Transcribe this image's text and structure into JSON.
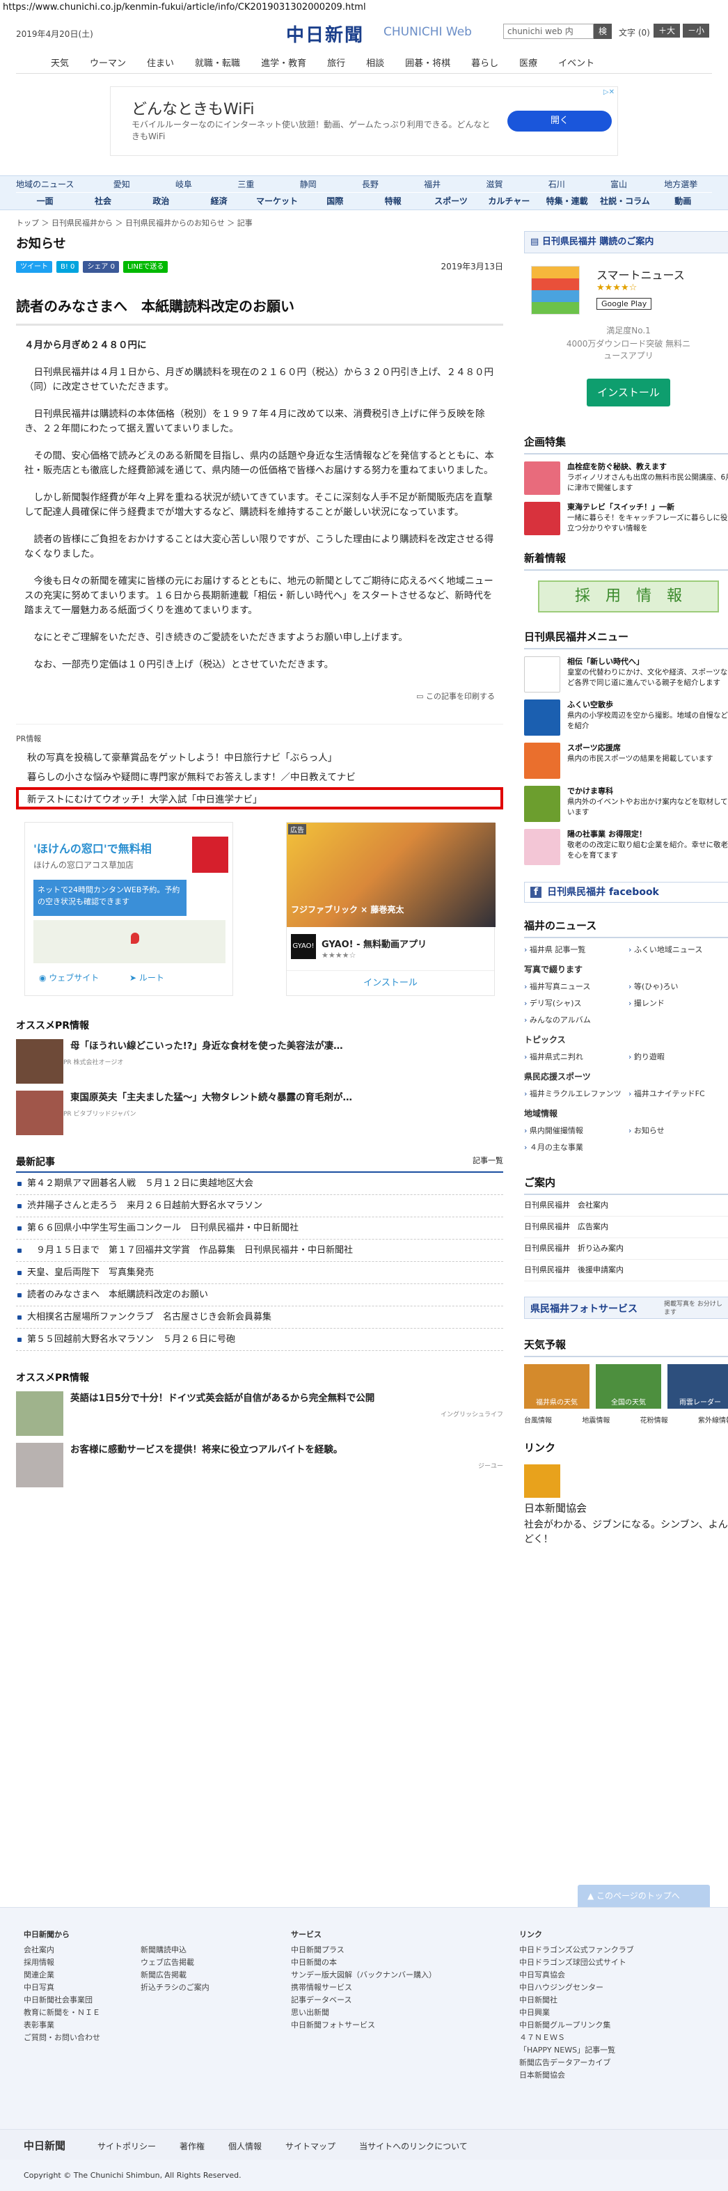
{
  "url": "https://www.chunichi.co.jp/kenmin-fukui/article/info/CK2019031302000209.html",
  "header": {
    "date": "2019年4月20日(土)",
    "logo": "中日新聞",
    "logo_en": "CHUNICHI Web",
    "search_placeholder": "chunichi web 内",
    "search_btn": "検",
    "moji": "文字 (0)",
    "big": "＋大",
    "small": "－小"
  },
  "gnav": [
    "天気",
    "ウーマン",
    "住まい",
    "就職・転職",
    "進学・教育",
    "旅行",
    "相談",
    "囲碁・将棋",
    "暮らし",
    "医療",
    "イベント"
  ],
  "ad_top": {
    "title": "どんなときもWiFi",
    "desc": "モバイルルーターなのにインターネット使い放題！動画、ゲームたっぷり利用できる。どんなときもWiFi",
    "btn": "開く"
  },
  "rnav1": [
    "地域のニュース",
    "愛知",
    "岐阜",
    "三重",
    "静岡",
    "長野",
    "福井",
    "滋賀",
    "石川",
    "富山",
    "地方選挙"
  ],
  "rnav2": [
    "一面",
    "社会",
    "政治",
    "経済",
    "マーケット",
    "国際",
    "特報",
    "スポーツ",
    "カルチャー",
    "特集・連載",
    "社説・コラム",
    "動画"
  ],
  "crumb": "トップ ＞ 日刊県民福井から ＞ 日刊県民福井からのお知らせ ＞ 記事",
  "page_title": "お知らせ",
  "share": {
    "tweet": "ツイート",
    "b": "B! 0",
    "fb": "シェア 0",
    "line": "LINEで送る",
    "date": "2019年3月13日"
  },
  "article": {
    "title": "読者のみなさまへ　本紙購読料改定のお願い",
    "lead": "４月から月ぎめ２４８０円に",
    "paras": [
      "日刊県民福井は４月１日から、月ぎめ購読料を現在の２１６０円（税込）から３２０円引き上げ、２４８０円（同）に改定させていただきます。",
      "日刊県民福井は購読料の本体価格（税別）を１９９７年４月に改めて以来、消費税引き上げに伴う反映を除き、２２年間にわたって据え置いてまいりました。",
      "その間、安心価格で読みどえのある新聞を目指し、県内の話題や身近な生活情報などを発信するとともに、本社・販売店とも徹底した経費節減を通じて、県内随一の低価格で皆様へお届けする努力を重ねてまいりました。",
      "しかし新聞製作経費が年々上昇を重ねる状況が続いてきています。そこに深刻な人手不足が新聞販売店を直撃して配達人員確保に伴う経費までが増大するなど、購読料を維持することが厳しい状況になっています。",
      "読者の皆様にご負担をおかけすることは大変心苦しい限りですが、こうした理由により購読料を改定させる得なくなりました。",
      "今後も日々の新聞を確実に皆様の元にお届けするとともに、地元の新聞としてご期待に応えるべく地域ニュースの充実に努めてまいります。１６日から長期新連載「相伝・新しい時代へ」をスタートさせるなど、新時代を踏まえて一層魅力ある紙面づくりを進めてまいります。",
      "なにとぞご理解をいただき、引き続きのご愛読をいただきますようお願い申し上げます。",
      "なお、一部売り定価は１０円引き上げ（税込）とさせていただきます。"
    ],
    "print": "この記事を印刷する"
  },
  "pr": {
    "head": "PR情報",
    "items": [
      "秋の写真を投稿して豪華賞品をゲットしよう！中日旅行ナビ「ぶらっ人」",
      "暮らしの小さな悩みや疑問に専門家が無料でお答えします！／中日教えてナビ"
    ],
    "highlight": "新テストにむけてウオッチ！大学入試「中日進学ナビ」"
  },
  "ad_left": {
    "title": "'ほけんの窓口'で無料相",
    "sub": "ほけんの窓口アコス草加店",
    "box": "ネットで24時間カンタンWEB予約。予約の空き状況も確認できます",
    "web": "ウェブサイト",
    "route": "ルート"
  },
  "ad_right": {
    "label": "広告",
    "brand": "フジファブリック × 藤巻亮太",
    "app": "GYAO! - 無料動画アプリ",
    "stars": "★★★★☆",
    "install": "インストール"
  },
  "osusume1": {
    "head": "オススメPR情報",
    "items": [
      {
        "text": "母「ほうれい線どこいった!?」身近な食材を使った美容法が凄…",
        "sp": "PR 株式会社オージオ"
      },
      {
        "text": "東国原英夫「主夫ました猛～」大物タレント続々暴露の育毛剤が…",
        "sp": "PR ビタブリッドジャパン"
      }
    ]
  },
  "latest": {
    "head": "最新記事",
    "more": "記事一覧",
    "items": [
      "第４２期県アマ囲碁名人戦　５月１２日に奥越地区大会",
      "渋井陽子さんと走ろう　来月２６日越前大野名水マラソン",
      "第６６回県小中学生写生画コンクール　日刊県民福井・中日新聞社",
      "　９月１５日まで　第１７回福井文学賞　作品募集　日刊県民福井・中日新聞社",
      "天皇、皇后両陛下　写真集発売",
      "読者のみなさまへ　本紙購読料改定のお願い",
      "大相撲名古屋場所ファンクラブ　名古屋さじき会新会員募集",
      "第５５回越前大野名水マラソン　５月２６日に号砲"
    ]
  },
  "osusume2": {
    "head": "オススメPR情報",
    "items": [
      {
        "text": "英語は1日5分で十分！ドイツ式英会話が自信があるから完全無料で公開",
        "sp": "イングリッシュライフ"
      },
      {
        "text": "お客様に感動サービスを提供！将来に役立つアルバイトを経験。",
        "sp": "ジーユー"
      }
    ]
  },
  "side": {
    "subscribe": "日刊県民福井 購読のご案内",
    "app": {
      "name": "スマートニュース",
      "stars": "★★★★☆",
      "gp": "Google Play",
      "d1": "満足度No.1",
      "d2": "4000万ダウンロード突破 無料ニュースアプリ",
      "install": "インストール"
    },
    "kikaku": {
      "head": "企画特集",
      "items": [
        {
          "t": "血栓症を防ぐ秘訣、教えます",
          "d": "ラボィノリオさんも出席の無料市民公開講座、6月に津市で開催します"
        },
        {
          "t": "東海テレビ「スイッチ！」一新",
          "d": "一緒に暮らそ！をキャッチフレーズに暮らしに役立つ分かりやすい情報を"
        }
      ]
    },
    "shinsotsu": {
      "head": "新着情報",
      "banner": "採　用　情　報"
    },
    "menu": {
      "head": "日刊県民福井メニュー",
      "items": [
        {
          "t": "相伝「新しい時代へ」",
          "d": "皇室の代替わりにかけ、文化や経済、スポーツなど各界で同じ道に進んでいる親子を紹介します"
        },
        {
          "t": "ふくい空散歩",
          "d": "県内の小学校周辺を空から撮影。地域の自慢などを紹介"
        },
        {
          "t": "スポーツ応援席",
          "d": "県内の市民スポーツの結果を掲載しています"
        },
        {
          "t": "でかけま専科",
          "d": "県内外のイベントやお出かけ案内などを取材しています"
        },
        {
          "t": "陽の社事業 お得限定！",
          "d": "敬老のの改定に取り組む企業を紹介。幸せに敬老を心を育てます"
        }
      ]
    },
    "facebook": "日刊県民福井 facebook",
    "fnews": {
      "head": "福井のニュース",
      "a": [
        "福井県 記事一覧",
        "ふくい地域ニュース"
      ],
      "b": "写真で綴ります",
      "c": [
        "福井写真ニュース",
        "等(ひゃ)ろい",
        "デリ写(シャ)ス",
        "撮レンド",
        "みんなのアルバム"
      ],
      "topics": "トピックス",
      "d": [
        "福井県式ニ判れ",
        "釣り遊暇"
      ],
      "sports": "県民応援スポーツ",
      "e": [
        "福井ミラクルエレファンツ",
        "福井ユナイテッドFC"
      ],
      "local": "地域情報",
      "f": [
        "県内開催撮情報",
        "お知らせ",
        "４月の主な事業"
      ]
    },
    "annai": {
      "head": "ご案内",
      "items": [
        "日刊県民福井　会社案内",
        "日刊県民福井　広告案内",
        "日刊県民福井　折り込み案内",
        "日刊県民福井　後援申請案内"
      ]
    },
    "photo": "県民福井フォトサービス",
    "photo_d": "掲載写真を お分けします",
    "weather": {
      "head": "天気予報",
      "cards": [
        "福井県の天気",
        "全国の天気",
        "雨雲レーダー"
      ],
      "links": [
        "台風情報",
        "地震情報",
        "花粉情報",
        "紫外線情報"
      ]
    },
    "link": {
      "head": "リンク",
      "name": "日本新聞協会",
      "desc": "社会がわかる、ジブンになる。シンブン、よんどく！"
    }
  },
  "totop": "このページのトップへ",
  "footer": {
    "col1": {
      "t": "中日新聞から",
      "items": [
        "会社案内",
        "採用情報",
        "関連企業",
        "中日写真",
        "中日新聞社会事業団",
        "教育に新聞を・ＮＩＥ",
        "表彰事業",
        "ご質問・お問い合わせ"
      ]
    },
    "col2": {
      "items": [
        "新聞購読申込",
        "ウェブ広告掲載",
        "新聞広告掲載",
        "折込チラシのご案内"
      ]
    },
    "col3": {
      "t": "サービス",
      "items": [
        "中日新聞プラス",
        "中日新聞の本",
        "サンデー版大図解（バックナンバー購入）",
        "携帯情報サービス",
        "記事データベース",
        "思い出新聞",
        "中日新聞フォトサービス"
      ]
    },
    "col4": {
      "t": "リンク",
      "items": [
        "中日ドラゴンズ公式ファンクラブ",
        "中日ドラゴンズ球団公式サイト",
        "中日写真協会",
        "中日ハウジングセンター",
        "中日新聞社",
        "中日興業",
        "中日新聞グループリンク集",
        "４７ＮＥＷＳ",
        "「HAPPY NEWS」記事一覧",
        "新聞広告データアーカイブ",
        "日本新聞協会"
      ]
    },
    "bar_logo": "中日新聞",
    "bar_links": [
      "サイトポリシー",
      "著作権",
      "個人情報",
      "サイトマップ",
      "当サイトへのリンクについて"
    ],
    "copy": "Copyright © The Chunichi Shimbun, All Rights Reserved."
  }
}
